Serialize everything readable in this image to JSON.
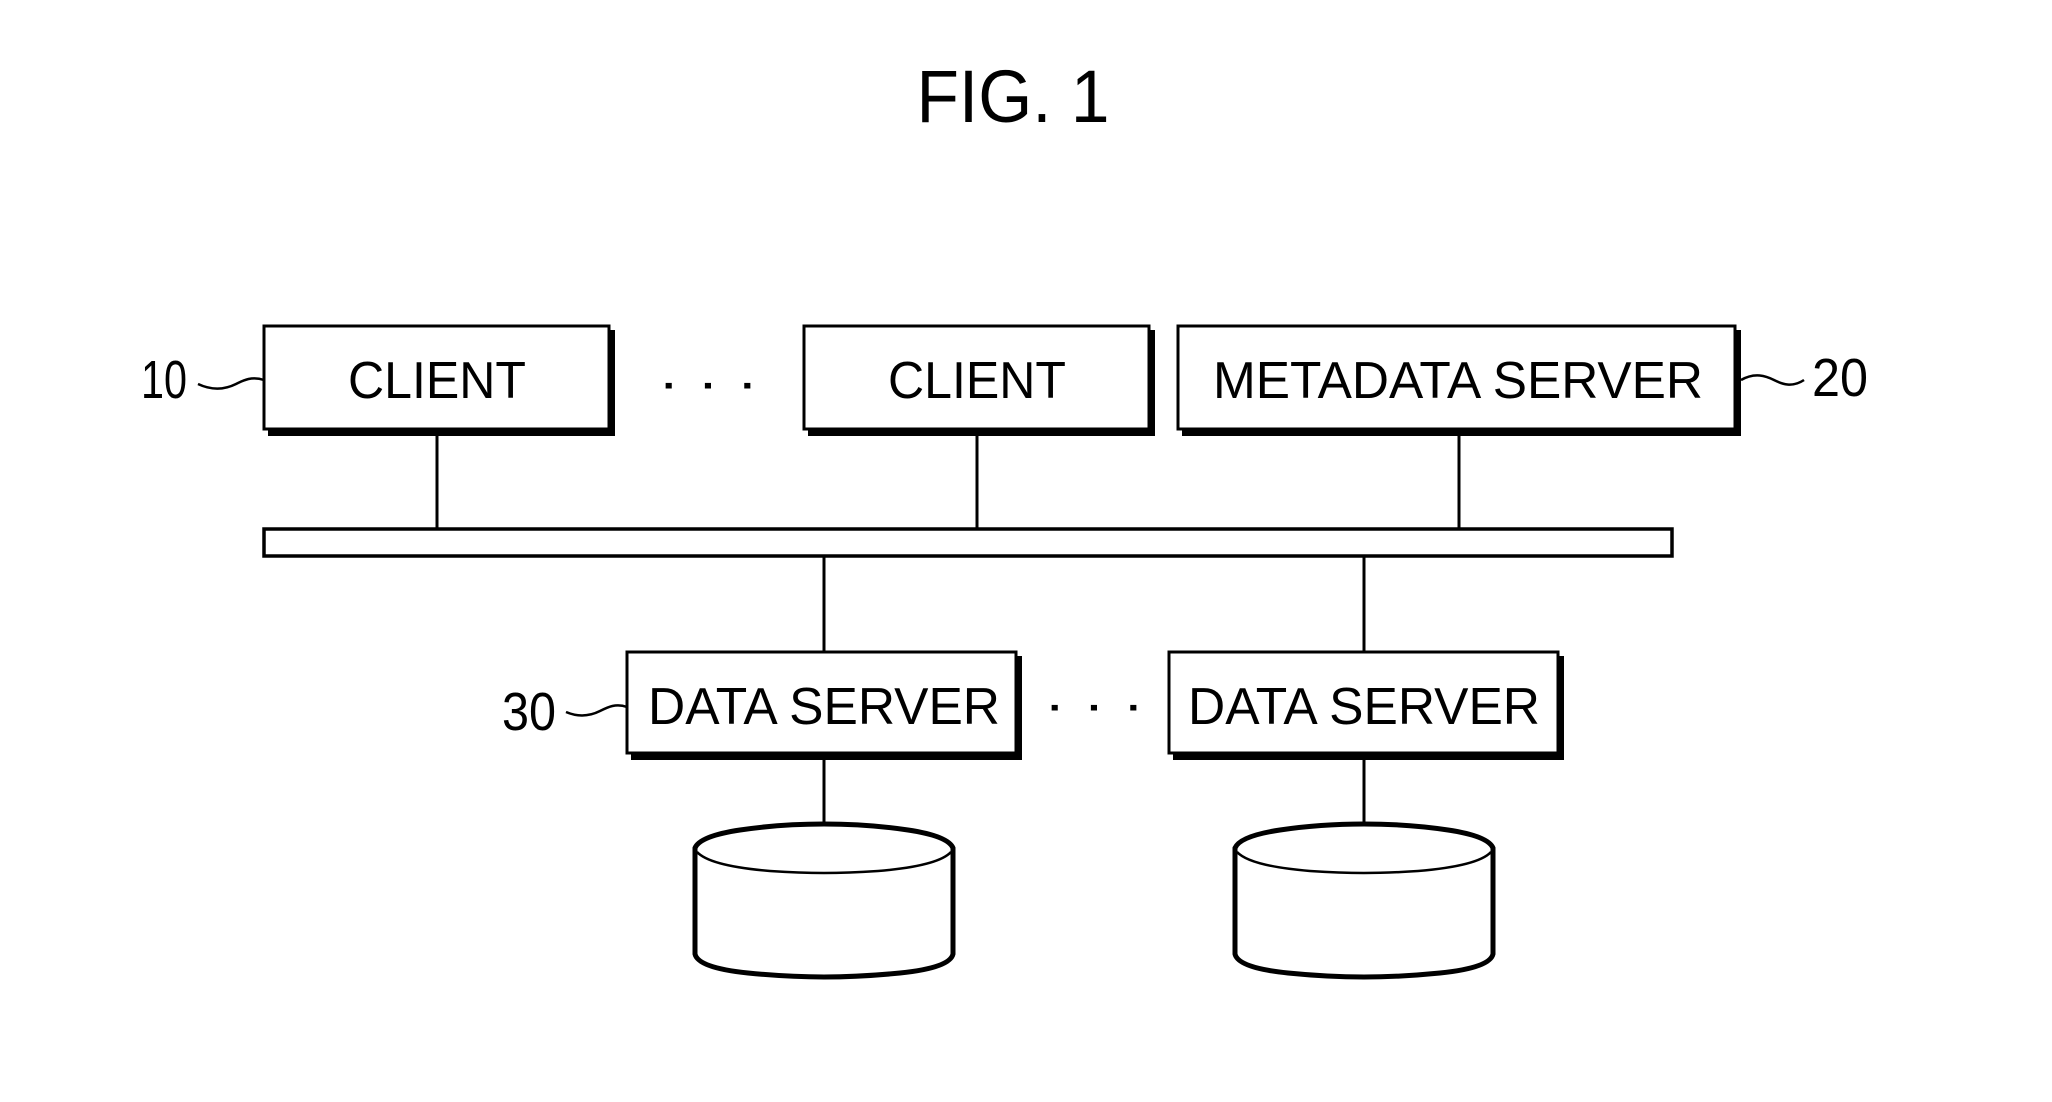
{
  "figure": {
    "title": "FIG. 1",
    "colors": {
      "line": "#000000",
      "background": "#ffffff"
    }
  },
  "nodes": {
    "client_1": {
      "label": "CLIENT",
      "ref": "10"
    },
    "client_n": {
      "label": "CLIENT"
    },
    "metadata_server": {
      "label": "METADATA SERVER",
      "ref": "20"
    },
    "data_server_1": {
      "label": "DATA SERVER",
      "ref": "30"
    },
    "data_server_n": {
      "label": "DATA SERVER"
    },
    "storage_1": {
      "label": "",
      "shape": "cylinder-icon"
    },
    "storage_n": {
      "label": "",
      "shape": "cylinder-icon"
    },
    "network_bus": {
      "label": "",
      "shape": "bar"
    }
  },
  "ellipsis": {
    "top": "· · ·",
    "bottom": "· · ·"
  },
  "edges": [
    {
      "from": "client_1",
      "to": "network_bus"
    },
    {
      "from": "client_n",
      "to": "network_bus"
    },
    {
      "from": "metadata_server",
      "to": "network_bus"
    },
    {
      "from": "network_bus",
      "to": "data_server_1"
    },
    {
      "from": "network_bus",
      "to": "data_server_n"
    },
    {
      "from": "data_server_1",
      "to": "storage_1"
    },
    {
      "from": "data_server_n",
      "to": "storage_n"
    }
  ]
}
